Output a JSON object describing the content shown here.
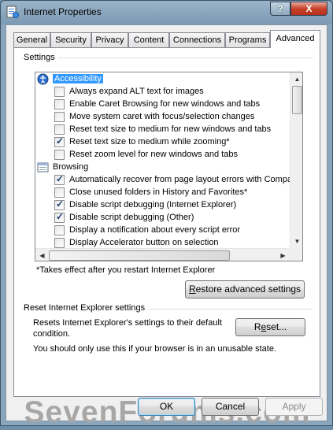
{
  "window": {
    "title": "Internet Properties",
    "help_glyph": "?",
    "close_glyph": "X"
  },
  "tabs": [
    "General",
    "Security",
    "Privacy",
    "Content",
    "Connections",
    "Programs",
    "Advanced"
  ],
  "active_tab": "Advanced",
  "settings_group": {
    "label": "Settings",
    "items": [
      {
        "type": "category",
        "label": "Accessibility",
        "icon": "accessibility-icon",
        "selected": true
      },
      {
        "type": "checkbox",
        "label": "Always expand ALT text for images",
        "checked": false
      },
      {
        "type": "checkbox",
        "label": "Enable Caret Browsing for new windows and tabs",
        "checked": false
      },
      {
        "type": "checkbox",
        "label": "Move system caret with focus/selection changes",
        "checked": false
      },
      {
        "type": "checkbox",
        "label": "Reset text size to medium for new windows and tabs",
        "checked": false
      },
      {
        "type": "checkbox",
        "label": "Reset text size to medium while zooming*",
        "checked": true
      },
      {
        "type": "checkbox",
        "label": "Reset zoom level for new windows and tabs",
        "checked": false
      },
      {
        "type": "category",
        "label": "Browsing",
        "icon": "browsing-icon",
        "selected": false
      },
      {
        "type": "checkbox",
        "label": "Automatically recover from page layout errors with Compa",
        "checked": true
      },
      {
        "type": "checkbox",
        "label": "Close unused folders in History and Favorites*",
        "checked": false
      },
      {
        "type": "checkbox",
        "label": "Disable script debugging (Internet Explorer)",
        "checked": true
      },
      {
        "type": "checkbox",
        "label": "Disable script debugging (Other)",
        "checked": true
      },
      {
        "type": "checkbox",
        "label": "Display a notification about every script error",
        "checked": false
      },
      {
        "type": "checkbox",
        "label": "Display Accelerator button on selection",
        "checked": false
      }
    ],
    "restart_note": "*Takes effect after you restart Internet Explorer",
    "restore_button": {
      "mnemonic": "R",
      "rest": "estore advanced settings"
    }
  },
  "reset_group": {
    "label": "Reset Internet Explorer settings",
    "description": "Resets Internet Explorer's settings to their default condition.",
    "reset_button": {
      "pre": "R",
      "mnemonic": "e",
      "rest": "set..."
    },
    "warning": "You should only use this if your browser is in an unusable state."
  },
  "footer": {
    "ok": "OK",
    "cancel": "Cancel",
    "apply": "Apply"
  },
  "watermark": "SevenForums.com",
  "colors": {
    "selection": "#3399ff",
    "title_gradient_top": "#9ab3c9",
    "close_red": "#c7422b"
  }
}
